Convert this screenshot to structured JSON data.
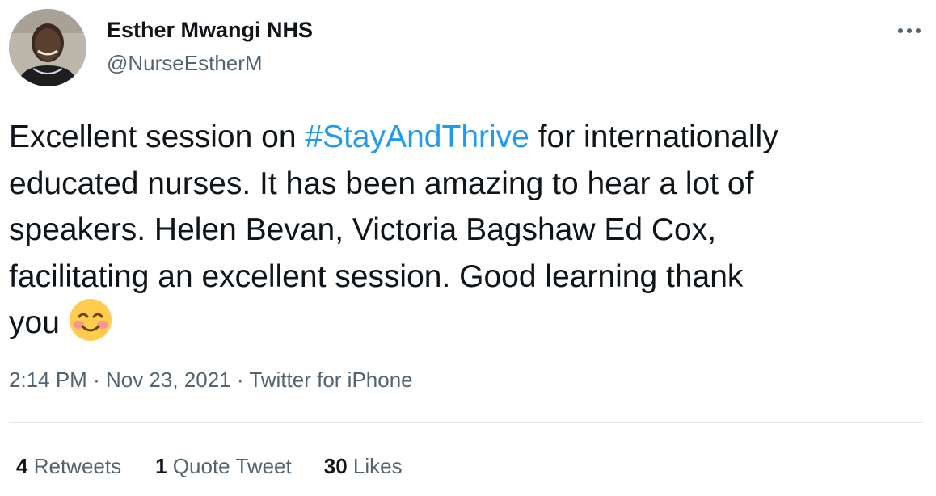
{
  "author": {
    "name": "Esther Mwangi NHS",
    "handle": "@NurseEstherM"
  },
  "tweet": {
    "lines": [
      {
        "before": "Excellent session on ",
        "hashtag": "#StayAndThrive",
        "after": " for internationally"
      },
      {
        "text": "educated nurses. It has been amazing to hear a lot of"
      },
      {
        "text": "speakers. Helen Bevan, Victoria Bagshaw Ed Cox,"
      },
      {
        "text": "facilitating an excellent session. Good learning thank"
      },
      {
        "text": "you"
      }
    ],
    "emoji": "smiling-face-with-smiling-eyes"
  },
  "meta": {
    "time": "2:14 PM",
    "separator": "·",
    "date": "Nov 23, 2021",
    "source": "Twitter for iPhone"
  },
  "stats": {
    "retweets_count": "4",
    "retweets_label": "Retweets",
    "quotes_count": "1",
    "quotes_label": "Quote Tweet",
    "likes_count": "30",
    "likes_label": "Likes"
  },
  "colors": {
    "hashtag": "#1d9bf0",
    "secondary_text": "#536471",
    "primary_text": "#0f1419",
    "divider": "#e1e8ed"
  },
  "icons": {
    "more": "more-horizontal-icon"
  }
}
